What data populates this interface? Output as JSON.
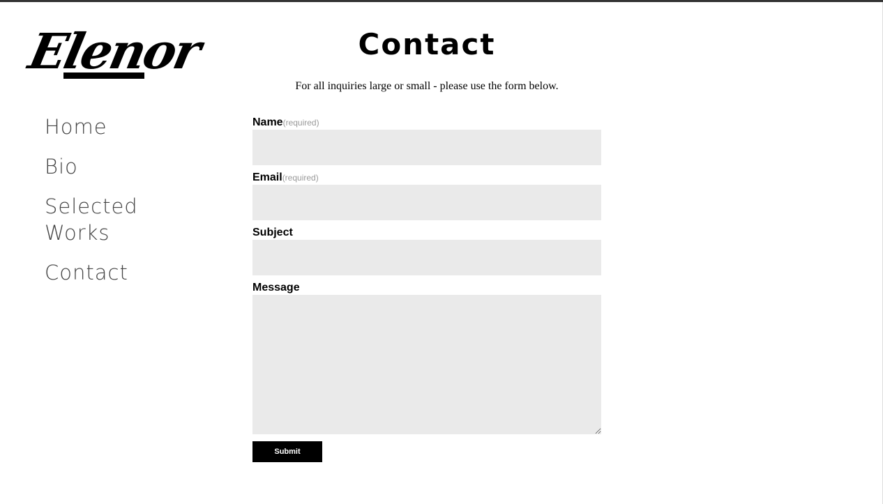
{
  "site": {
    "logo_text": "Elenor"
  },
  "nav": {
    "items": [
      {
        "label": "Home"
      },
      {
        "label": "Bio"
      },
      {
        "label": "Selected Works"
      },
      {
        "label": "Contact"
      }
    ]
  },
  "page": {
    "title": "Contact",
    "intro": "For all inquiries large or small - please use the form below."
  },
  "form": {
    "name_label": "Name",
    "email_label": "Email",
    "subject_label": "Subject",
    "message_label": "Message",
    "required_text": "(required)",
    "name_value": "",
    "email_value": "",
    "subject_value": "",
    "message_value": "",
    "submit_label": "Submit"
  },
  "colors": {
    "accent": "#000000",
    "field_background": "#eaeaea",
    "nav_text": "#444444",
    "required_text": "#999999"
  }
}
